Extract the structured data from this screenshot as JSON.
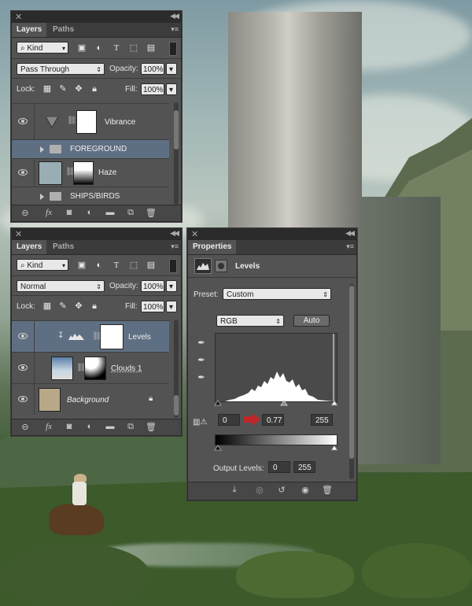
{
  "layers_panel_1": {
    "tabs": [
      {
        "label": "Layers"
      },
      {
        "label": "Paths"
      }
    ],
    "filter": {
      "value": "Kind"
    },
    "blend_mode": {
      "value": "Pass Through"
    },
    "opacity_label": "Opacity:",
    "opacity_value": "100%",
    "lock_label": "Lock:",
    "fill_label": "Fill:",
    "fill_value": "100%",
    "layers": [
      {
        "name": "Vibrance"
      },
      {
        "name": "FOREGROUND"
      },
      {
        "name": "Haze"
      },
      {
        "name": "SHIPS/BIRDS"
      }
    ]
  },
  "layers_panel_2": {
    "tabs": [
      {
        "label": "Layers"
      },
      {
        "label": "Paths"
      }
    ],
    "filter": {
      "value": "Kind"
    },
    "blend_mode": {
      "value": "Normal"
    },
    "opacity_label": "Opacity:",
    "opacity_value": "100%",
    "lock_label": "Lock:",
    "fill_label": "Fill:",
    "fill_value": "100%",
    "layers": [
      {
        "name": "Levels"
      },
      {
        "name": "Clouds 1"
      },
      {
        "name": "Background"
      }
    ]
  },
  "properties_panel": {
    "tab": "Properties",
    "title": "Levels",
    "preset_label": "Preset:",
    "preset_value": "Custom",
    "channel_value": "RGB",
    "auto_label": "Auto",
    "input_black": "0",
    "input_mid": "0.77",
    "input_white": "255",
    "output_label": "Output Levels:",
    "output_black": "0",
    "output_white": "255"
  },
  "colors": {
    "panel_bg": "#535353",
    "selected_row": "#5f6f83",
    "arrow_red": "#c0262b"
  }
}
